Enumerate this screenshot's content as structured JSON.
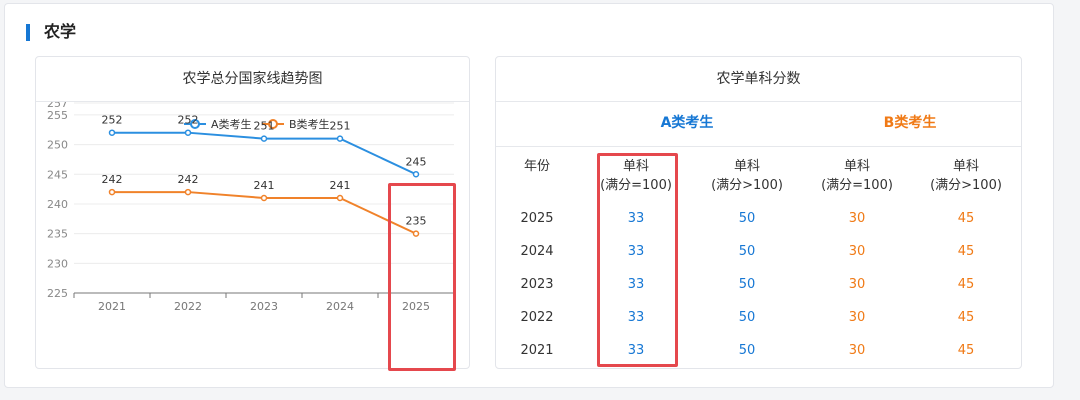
{
  "section": {
    "title": "农学"
  },
  "chart_data": {
    "type": "line",
    "title": "农学总分国家线趋势图",
    "categories": [
      "2021",
      "2022",
      "2023",
      "2024",
      "2025"
    ],
    "series": [
      {
        "name": "A类考生",
        "values": [
          252,
          252,
          251,
          251,
          245
        ],
        "color": "#2b8fe0"
      },
      {
        "name": "B类考生",
        "values": [
          242,
          242,
          241,
          241,
          235
        ],
        "color": "#f0822a"
      }
    ],
    "yticks": [
      225,
      230,
      235,
      240,
      245,
      250,
      255,
      257
    ],
    "ylim": [
      225,
      257
    ],
    "legend": "top-center",
    "grid": true
  },
  "table": {
    "title": "农学单科分数",
    "group_a": "A类考生",
    "group_b": "B类考生",
    "year_header": "年份",
    "headers": [
      {
        "line1": "单科",
        "line2": "(满分=100)"
      },
      {
        "line1": "单科",
        "line2": "(满分>100)"
      },
      {
        "line1": "单科",
        "line2": "(满分=100)"
      },
      {
        "line1": "单科",
        "line2": "(满分>100)"
      }
    ],
    "rows": [
      {
        "year": "2025",
        "vals": [
          "33",
          "50",
          "30",
          "45"
        ]
      },
      {
        "year": "2024",
        "vals": [
          "33",
          "50",
          "30",
          "45"
        ]
      },
      {
        "year": "2023",
        "vals": [
          "33",
          "50",
          "30",
          "45"
        ]
      },
      {
        "year": "2022",
        "vals": [
          "33",
          "50",
          "30",
          "45"
        ]
      },
      {
        "year": "2021",
        "vals": [
          "33",
          "50",
          "30",
          "45"
        ]
      }
    ]
  },
  "colors": {
    "accent": "#1677d4",
    "orange": "#f07a16",
    "highlight": "#e5484d"
  }
}
